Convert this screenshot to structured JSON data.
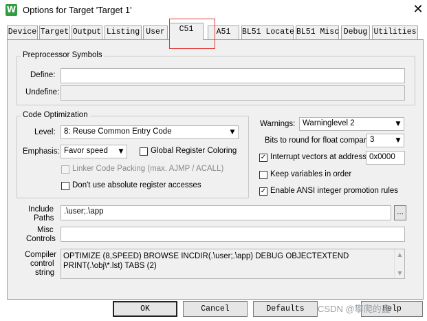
{
  "window": {
    "title": "Options for Target 'Target 1'"
  },
  "tabs": [
    {
      "label": "Device"
    },
    {
      "label": "Target"
    },
    {
      "label": "Output"
    },
    {
      "label": "Listing"
    },
    {
      "label": "User"
    },
    {
      "label": "C51",
      "active": true
    },
    {
      "label": "A51"
    },
    {
      "label": "BL51 Locate"
    },
    {
      "label": "BL51 Misc"
    },
    {
      "label": "Debug"
    },
    {
      "label": "Utilities"
    }
  ],
  "preprocessor": {
    "title": "Preprocessor Symbols",
    "define_label": "Define:",
    "define_value": "",
    "undefine_label": "Undefine:",
    "undefine_value": ""
  },
  "optimization": {
    "title": "Code Optimization",
    "level_label": "Level:",
    "level_value": "8: Reuse Common Entry Code",
    "emphasis_label": "Emphasis:",
    "emphasis_value": "Favor speed",
    "global_register_coloring": {
      "label": "Global Register Coloring",
      "checked": false
    },
    "linker_code_packing": {
      "label": "Linker Code Packing (max. AJMP / ACALL)",
      "checked": false,
      "disabled": true
    },
    "no_absolute_register": {
      "label": "Don't use absolute register accesses",
      "checked": false
    }
  },
  "right_options": {
    "warnings_label": "Warnings:",
    "warnings_value": "Warninglevel 2",
    "bits_round_label": "Bits to round for float compare:",
    "bits_round_value": "3",
    "interrupt_vectors": {
      "label": "Interrupt vectors at address:",
      "checked": true,
      "address": "0x0000"
    },
    "keep_variables": {
      "label": "Keep variables in order",
      "checked": false
    },
    "ansi_integer": {
      "label": "Enable ANSI integer promotion rules",
      "checked": true
    }
  },
  "paths": {
    "include_label_1": "Include",
    "include_label_2": "Paths",
    "include_value": ".\\user;.\\app",
    "browse_label": "...",
    "misc_label_1": "Misc",
    "misc_label_2": "Controls",
    "misc_value": "",
    "compiler_label_1": "Compiler",
    "compiler_label_2": "control",
    "compiler_label_3": "string",
    "compiler_value": "OPTIMIZE (8,SPEED) BROWSE INCDIR(.\\user;.\\app) DEBUG OBJECTEXTEND PRINT(.\\obj\\*.lst) TABS (2)"
  },
  "buttons": {
    "ok": "OK",
    "cancel": "Cancel",
    "defaults": "Defaults",
    "help": "Help"
  },
  "watermark": "CSDN @攀爬的鑫"
}
